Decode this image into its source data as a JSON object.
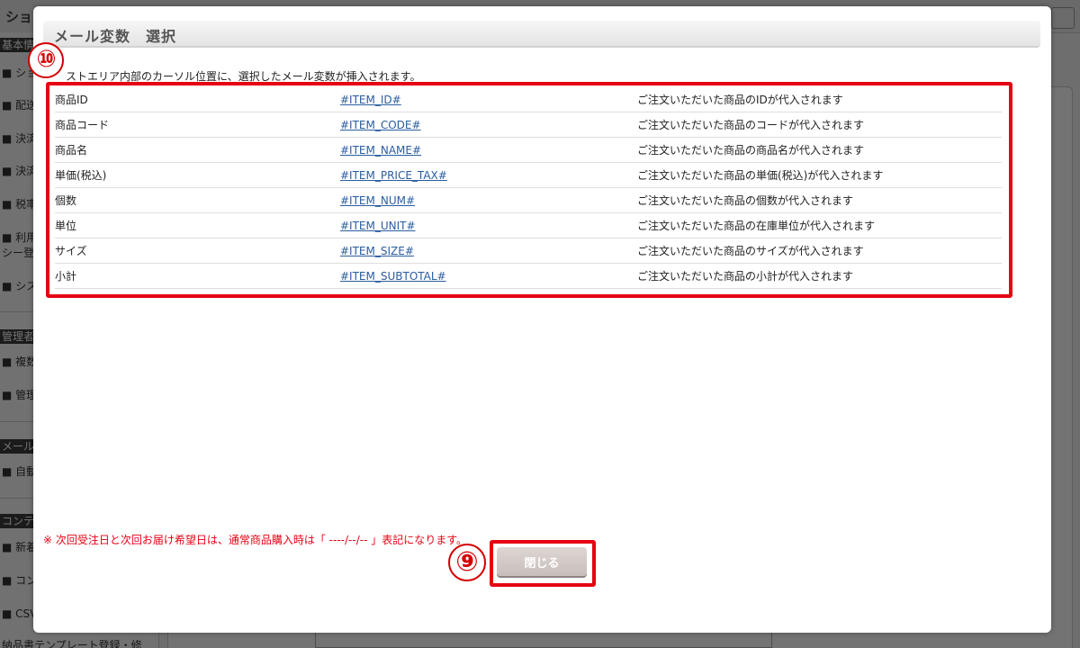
{
  "background": {
    "header_title": "ショ",
    "sidebar": {
      "sections": [
        "基本情",
        "管理者",
        "メール",
        "コンテ"
      ],
      "items": [
        "■ ショ",
        "■ 配送",
        "■ 決済",
        "■ 決済",
        "■ 税率",
        "■ 利用",
        "シー登",
        "■ シス",
        "■ 複数",
        "■ 管理",
        "■ 自動",
        "■ 新着",
        "■ コン",
        "■ CSV",
        "納品書テンプレート登録・修"
      ]
    }
  },
  "modal": {
    "title": "メール変数　選択",
    "instructions": "ストエリア内部のカーソル位置に、選択したメール変数が挿入されます。",
    "markers": {
      "table": "⑩",
      "close": "⑨"
    },
    "rows": [
      {
        "name": "商品ID",
        "variable": "#ITEM_ID#",
        "description": "ご注文いただいた商品のIDが代入されます"
      },
      {
        "name": "商品コード",
        "variable": "#ITEM_CODE#",
        "description": "ご注文いただいた商品のコードが代入されます"
      },
      {
        "name": "商品名",
        "variable": "#ITEM_NAME#",
        "description": "ご注文いただいた商品の商品名が代入されます"
      },
      {
        "name": "単価(税込)",
        "variable": "#ITEM_PRICE_TAX#",
        "description": "ご注文いただいた商品の単価(税込)が代入されます"
      },
      {
        "name": "個数",
        "variable": "#ITEM_NUM#",
        "description": "ご注文いただいた商品の個数が代入されます"
      },
      {
        "name": "単位",
        "variable": "#ITEM_UNIT#",
        "description": "ご注文いただいた商品の在庫単位が代入されます"
      },
      {
        "name": "サイズ",
        "variable": "#ITEM_SIZE#",
        "description": "ご注文いただいた商品のサイズが代入されます"
      },
      {
        "name": "小計",
        "variable": "#ITEM_SUBTOTAL#",
        "description": "ご注文いただいた商品の小計が代入されます"
      }
    ],
    "note": "※ 次回受注日と次回お届け希望日は、通常商品購入時は「 ----/--/-- 」表記になります。",
    "close_label": "閉じる"
  },
  "colors": {
    "highlight": "#e60012",
    "link": "#2a5d9f",
    "note": "#e60012"
  }
}
